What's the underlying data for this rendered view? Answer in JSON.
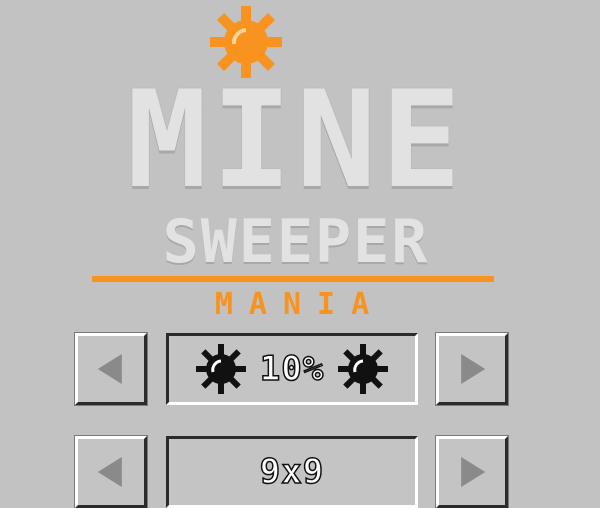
{
  "logo": {
    "line1": "MINE",
    "line2": "SWEEPER",
    "line3": "MANIA",
    "accent_color": "#f7931e",
    "icon": "sun-gear-icon"
  },
  "settings": {
    "mine_density": {
      "value": "10%",
      "icons": [
        "mine-icon",
        "mine-icon"
      ],
      "prev_icon": "arrow-left-icon",
      "next_icon": "arrow-right-icon"
    },
    "grid_size": {
      "value": "9x9",
      "prev_icon": "arrow-left-icon",
      "next_icon": "arrow-right-icon"
    }
  },
  "colors": {
    "background": "#c2c2c2",
    "button_face": "#c4c4c4",
    "arrow": "#8a8a8a"
  }
}
